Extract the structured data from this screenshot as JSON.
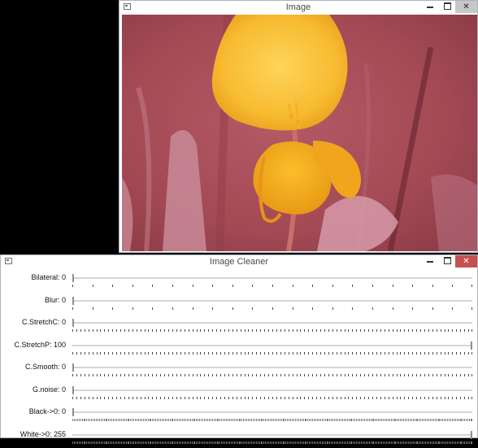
{
  "image_window": {
    "title": "Image",
    "controls": {
      "minimize_icon": "minimize-icon",
      "maximize_icon": "maximize-icon",
      "close_icon": "close-icon"
    }
  },
  "cleaner_window": {
    "title": "Image Cleaner",
    "controls": {
      "minimize_icon": "minimize-icon",
      "maximize_icon": "maximize-icon",
      "close_icon": "close-icon"
    }
  },
  "colors": {
    "photo_background": "#a34a55",
    "petal": "#f7bb31",
    "close_active": "#c75050"
  },
  "trackbars": [
    {
      "label": "Bilateral: 0",
      "value": 0,
      "max": 20
    },
    {
      "label": "Blur: 0",
      "value": 0,
      "max": 20
    },
    {
      "label": "C.StretchC: 0",
      "value": 0,
      "max": 100
    },
    {
      "label": "C.StretchP: 100",
      "value": 100,
      "max": 100
    },
    {
      "label": "C.Smooth: 0",
      "value": 0,
      "max": 100
    },
    {
      "label": "G.noise: 0",
      "value": 0,
      "max": 100
    },
    {
      "label": "Black->0: 0",
      "value": 0,
      "max": 255
    },
    {
      "label": "White->0: 255",
      "value": 255,
      "max": 255
    }
  ]
}
